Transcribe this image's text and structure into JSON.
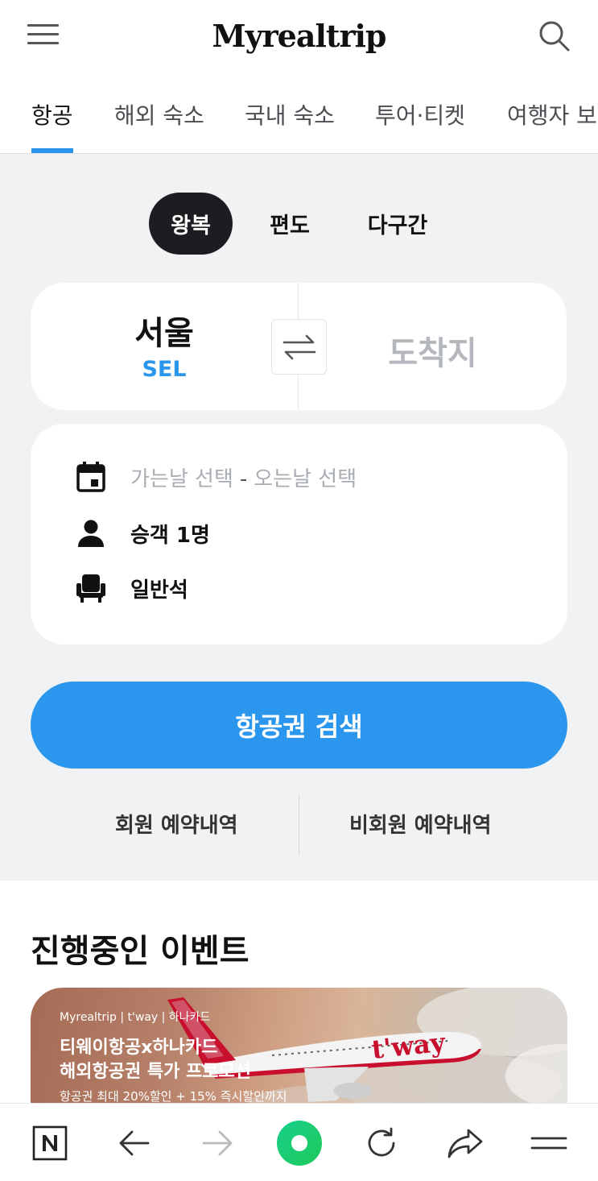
{
  "header": {
    "logo": "Myrealtrip",
    "menu_icon": "hamburger-menu-icon",
    "search_icon": "search-icon"
  },
  "tabs": [
    {
      "label": "항공",
      "active": true
    },
    {
      "label": "해외 숙소"
    },
    {
      "label": "국내 숙소"
    },
    {
      "label": "투어·티켓"
    },
    {
      "label": "여행자 보"
    }
  ],
  "trip_types": [
    {
      "label": "왕복",
      "active": true
    },
    {
      "label": "편도"
    },
    {
      "label": "다구간"
    }
  ],
  "route": {
    "origin_city": "서울",
    "origin_code": "SEL",
    "destination_placeholder": "도착지",
    "swap_icon": "swap-arrows-icon"
  },
  "options": {
    "date_depart": "가는날 선택",
    "date_separator": "-",
    "date_return": "오는날 선택",
    "passengers": "승객 1명",
    "seat_class": "일반석"
  },
  "search_button": "항공권 검색",
  "reservations": {
    "member": "회원 예약내역",
    "non_member": "비회원 예약내역"
  },
  "events": {
    "title": "진행중인 이벤트",
    "banner": {
      "brand": "Myrealtrip | t'way | 하나카드",
      "title_line1": "티웨이항공x하나카드",
      "title_line2": "해외항공권 특가 프로모션",
      "subtitle": "항공권 최대 20%할인 + 15% 즉시할인까지"
    }
  },
  "bottom_nav": [
    "naver-n-icon",
    "back-arrow-icon",
    "forward-arrow-icon",
    "home-green-dot-icon",
    "refresh-icon",
    "share-icon",
    "menu-lines-icon"
  ],
  "colors": {
    "accent": "#2b96ed",
    "dark": "#1b1d20",
    "panel_bg": "#f1f2f4",
    "nav_green": "#1ec971"
  }
}
